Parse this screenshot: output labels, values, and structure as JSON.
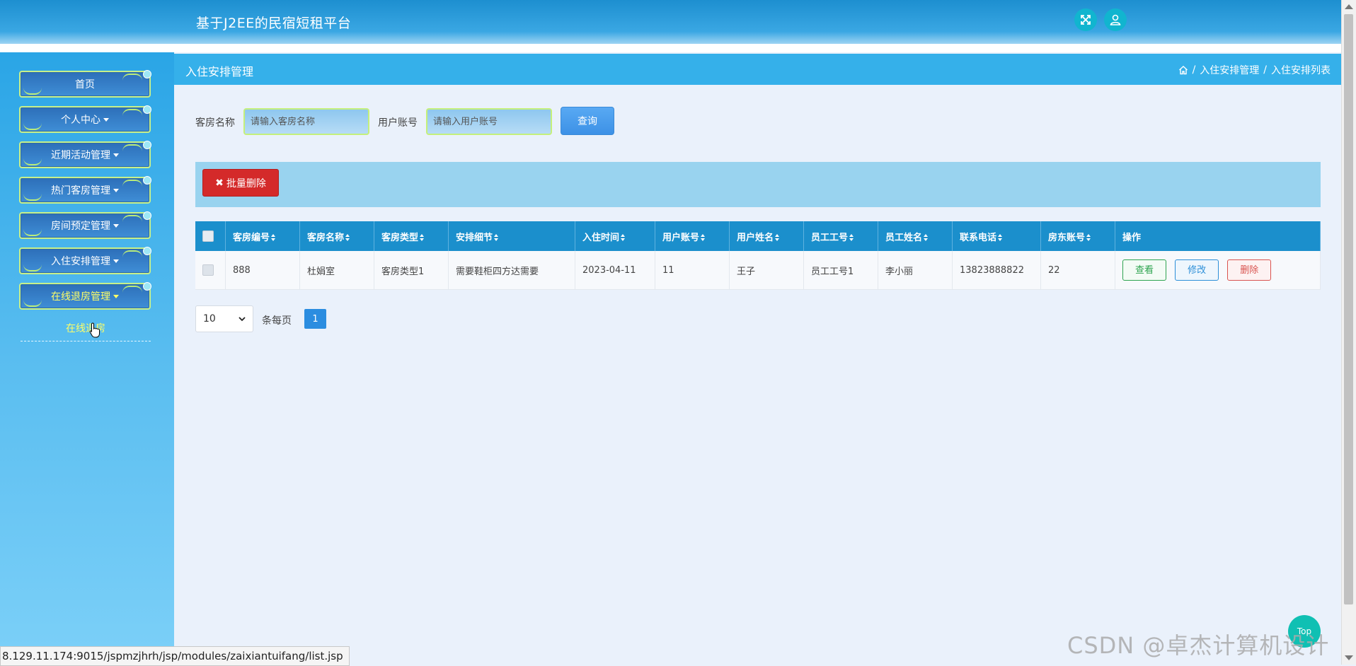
{
  "header": {
    "app_title": "基于J2EE的民宿短租平台",
    "fullscreen_icon": "expand-arrows-icon",
    "user_icon": "user-icon"
  },
  "sidebar": {
    "items": [
      {
        "label": "首页",
        "has_caret": false
      },
      {
        "label": "个人中心",
        "has_caret": true
      },
      {
        "label": "近期活动管理",
        "has_caret": true
      },
      {
        "label": "热门客房管理",
        "has_caret": true
      },
      {
        "label": "房间预定管理",
        "has_caret": true
      },
      {
        "label": "入住安排管理",
        "has_caret": true
      },
      {
        "label": "在线退房管理",
        "has_caret": true,
        "active": true
      }
    ],
    "submenu": {
      "label": "在线退房"
    }
  },
  "page": {
    "title": "入住安排管理",
    "breadcrumb": [
      "入住安排管理",
      "入住安排列表"
    ],
    "breadcrumb_sep": "/"
  },
  "search": {
    "room_name_label": "客房名称",
    "room_name_placeholder": "请输入客房名称",
    "user_account_label": "用户账号",
    "user_account_placeholder": "请输入用户账号",
    "query_button": "查询"
  },
  "toolbar": {
    "batch_delete": "批量删除"
  },
  "table": {
    "columns": [
      "客房编号",
      "客房名称",
      "客房类型",
      "安排细节",
      "入住时间",
      "用户账号",
      "用户姓名",
      "员工工号",
      "员工姓名",
      "联系电话",
      "房东账号",
      "操作"
    ],
    "rows": [
      {
        "cells": [
          "888",
          "杜娟室",
          "客房类型1",
          "需要鞋柜四方达需要",
          "2023-04-11",
          "11",
          "王子",
          "员工工号1",
          "李小丽",
          "13823888822",
          "22"
        ],
        "actions": {
          "view": "查看",
          "edit": "修改",
          "delete": "删除"
        }
      }
    ]
  },
  "pagination": {
    "page_size": "10",
    "per_page_label": "条每页",
    "current_page": "1"
  },
  "status_bar": {
    "url": "8.129.11.174:9015/jspmzjhrh/jsp/modules/zaixiantuifang/list.jsp"
  },
  "overlay": {
    "watermark": "CSDN @卓杰计算机设计",
    "top_button": "Top"
  },
  "colors": {
    "header_blue": "#1d8fd0",
    "page_header": "#35b0ea",
    "table_header": "#1b8fcc",
    "danger": "#d42a2a",
    "active_menu_text": "#ffff66"
  }
}
